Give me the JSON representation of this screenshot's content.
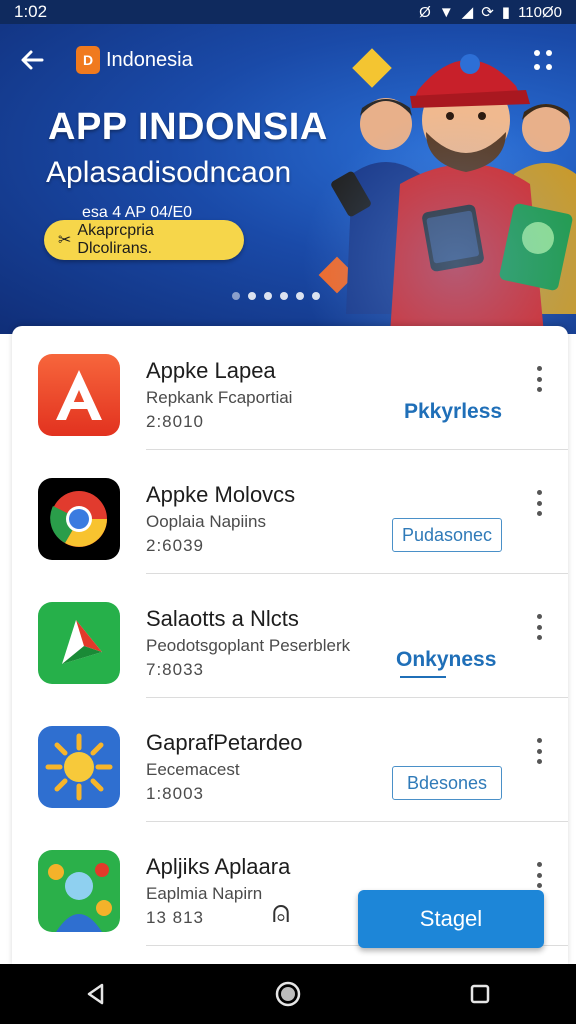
{
  "status_bar": {
    "time": "1:02",
    "battery": "110Ø0",
    "icons": [
      "data-saver-icon",
      "wifi-icon",
      "signal-icon",
      "sync-icon",
      "battery-icon"
    ]
  },
  "header": {
    "country": "Indonesia",
    "country_badge": "D"
  },
  "banner": {
    "title": "APP INDONSIA",
    "subtitle": "Aplasadisodncaon",
    "small_text": "esa 4 AP 04/E0",
    "pill_label": "Akaprcpria Dlcolirans.",
    "pill_icon": "✂",
    "page_count": 6
  },
  "apps": [
    {
      "name": "Appke Lapea",
      "subtitle": "Repkank Fcaportiai",
      "meta": "2:8010",
      "action": "Pkkyrless",
      "action_style": "text"
    },
    {
      "name": "Appke Molovcs",
      "subtitle": "Ooplaia Napiins",
      "meta": "2:6039",
      "action": "Pudasonec",
      "action_style": "outline"
    },
    {
      "name": "Salaotts a Nlcts",
      "subtitle": "Peodotsgoplant Peserblerk",
      "meta": "7:8033",
      "action": "Onkyness",
      "action_style": "text-underline"
    },
    {
      "name": "GaprafPetardeo",
      "subtitle": "Eecemacest",
      "meta": "1:8003",
      "action": "Bdesones",
      "action_style": "outline"
    },
    {
      "name": "Apljiks Aplaara",
      "subtitle": "Eaplmia Napirn",
      "meta": "13 813",
      "action": "",
      "action_style": "none"
    }
  ],
  "fab": {
    "label": "Stagel"
  },
  "cursor_glyph": "⍝",
  "colors": {
    "hero": "#1a4aa8",
    "accent": "#1d86d8",
    "pill": "#f6d64a"
  }
}
